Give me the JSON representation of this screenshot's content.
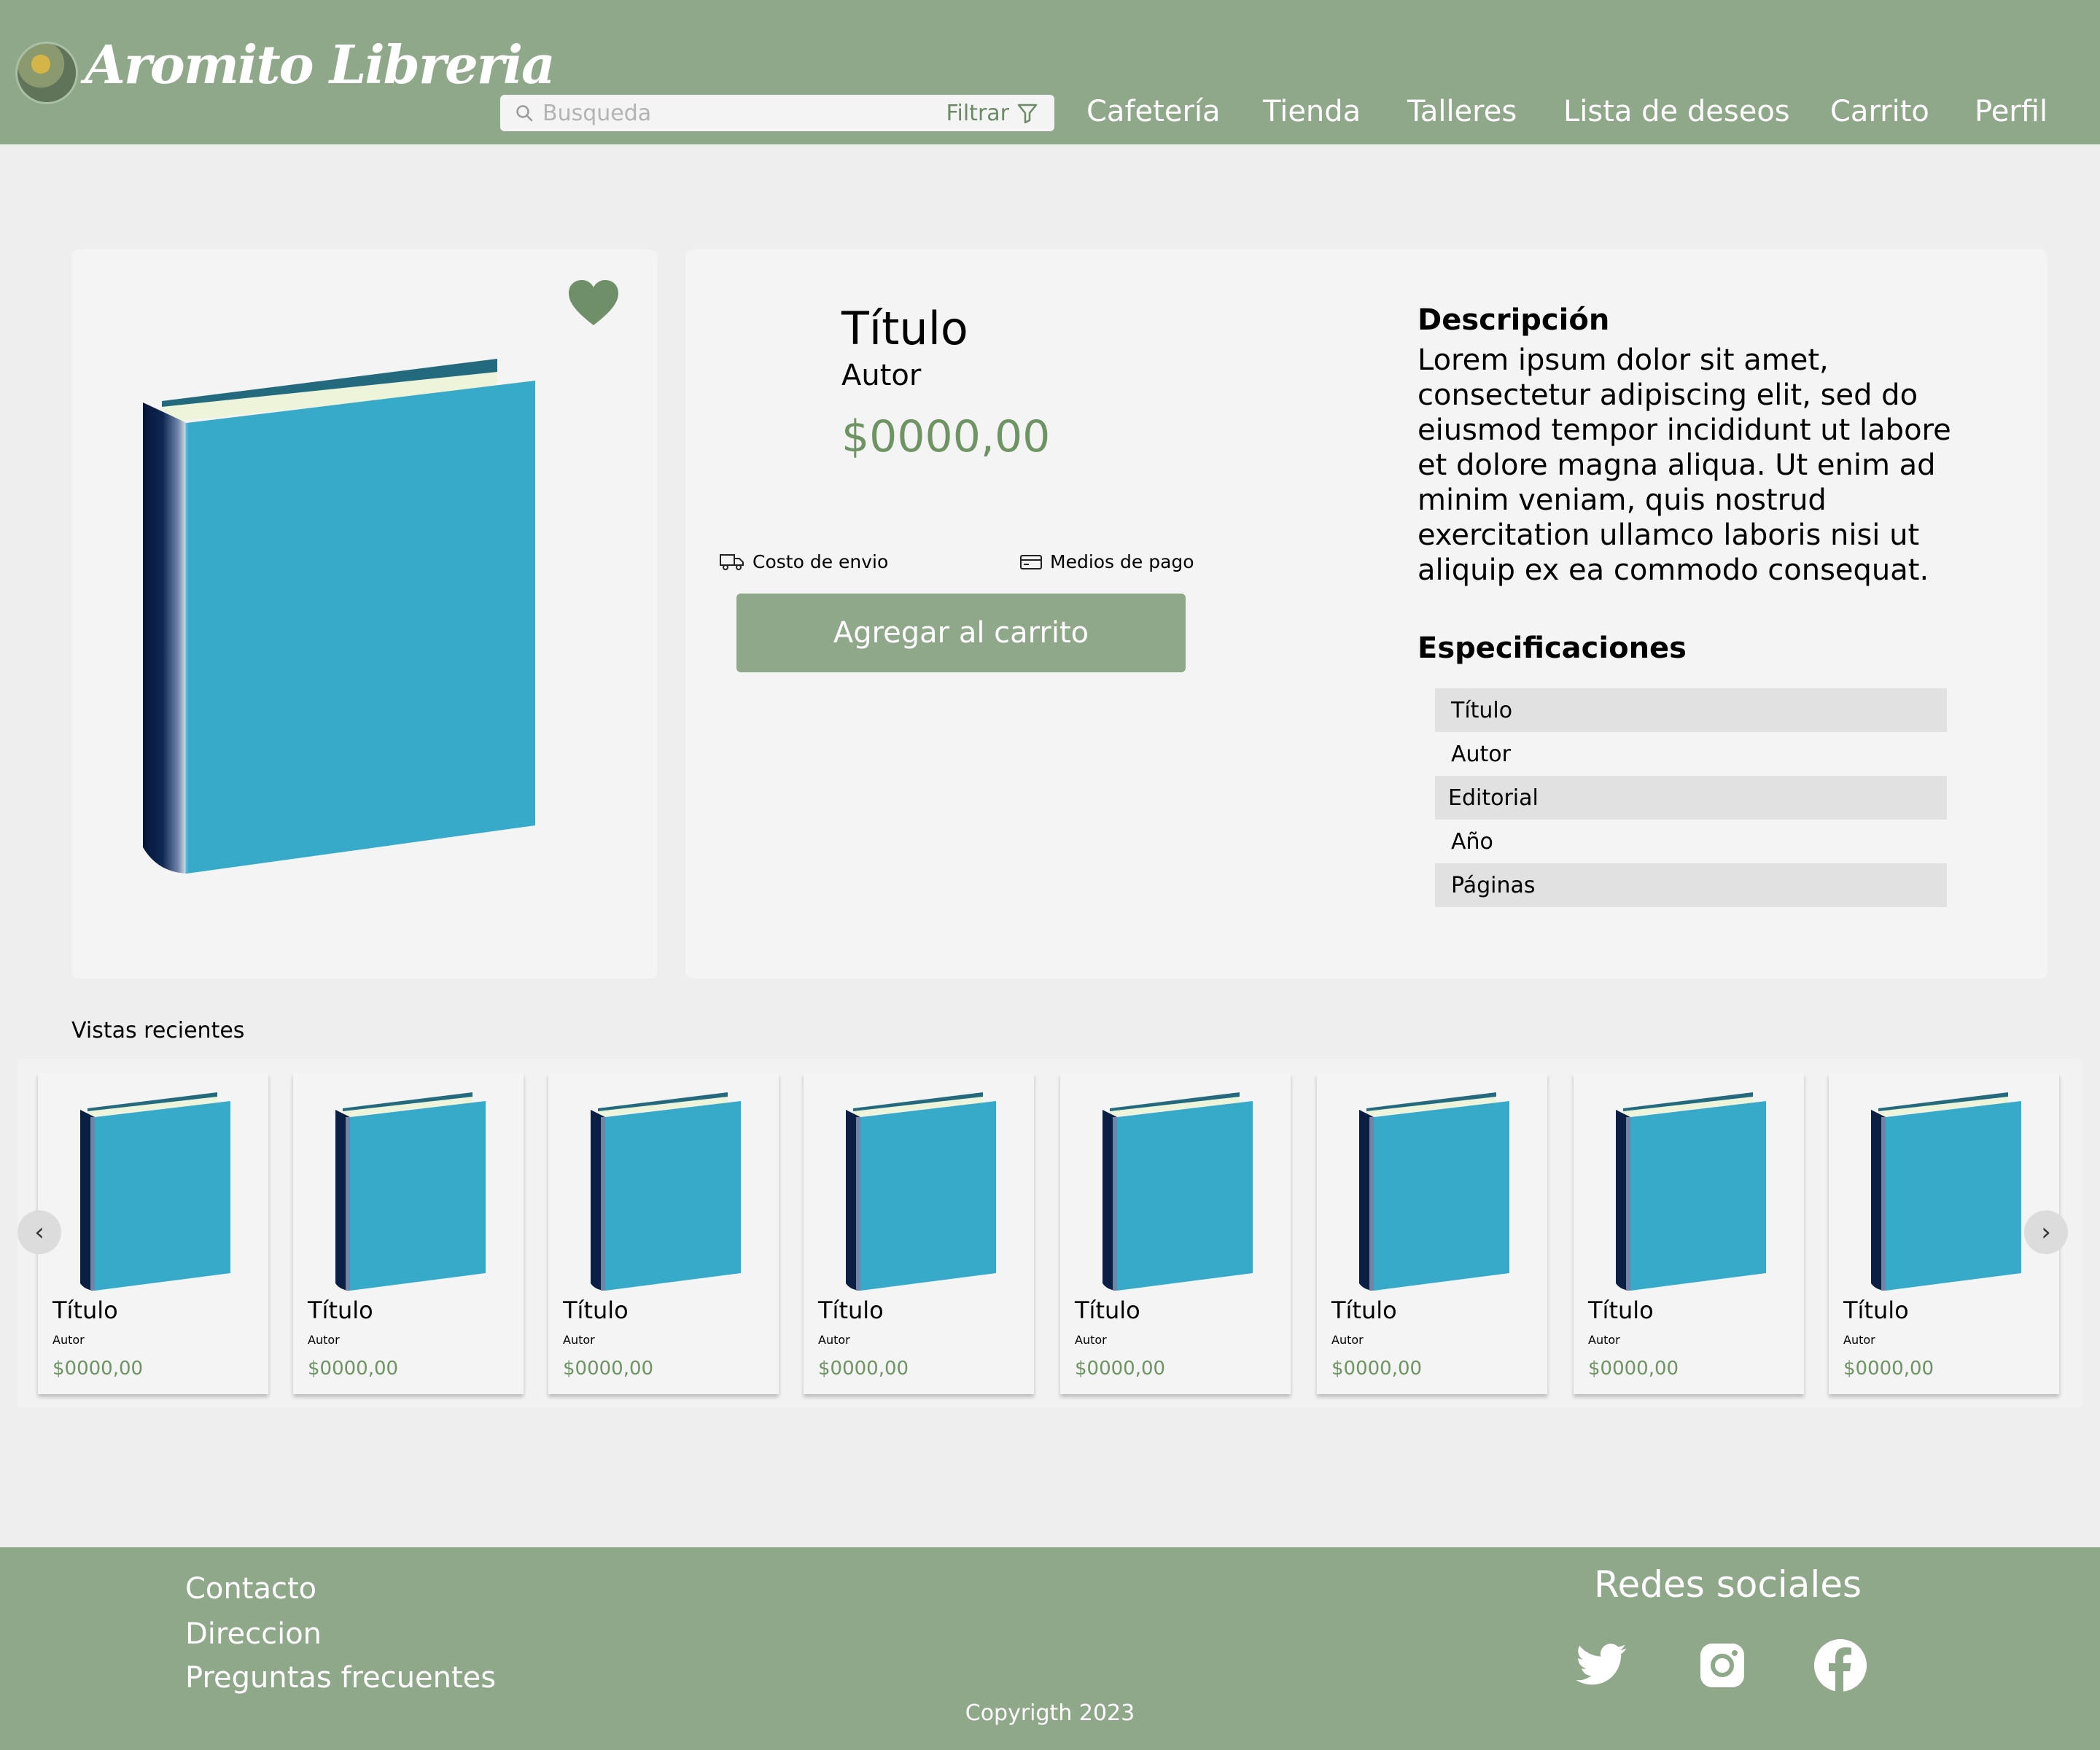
{
  "header": {
    "brand": "Aromito Libreria",
    "search_placeholder": "Busqueda",
    "filter_label": "Filtrar",
    "nav": [
      "Cafetería",
      "Tienda",
      "Talleres",
      "Lista de deseos",
      "Carrito",
      "Perfil"
    ]
  },
  "product": {
    "title": "Título",
    "author": "Autor",
    "price": "$0000,00",
    "shipping_label": "Costo de envio",
    "payment_label": "Medios de pago",
    "add_to_cart": "Agregar al carrito",
    "description_heading": "Descripción",
    "description": "Lorem ipsum dolor sit amet, consectetur adipiscing elit, sed do eiusmod tempor incididunt ut labore et dolore magna aliqua. Ut enim ad minim veniam, quis nostrud exercitation ullamco laboris nisi ut aliquip ex ea commodo consequat.",
    "specs_heading": "Especificaciones",
    "specs": [
      "Título",
      "Autor",
      "Editorial",
      "Año",
      "Páginas"
    ]
  },
  "recent": {
    "label": "Vistas recientes",
    "items": [
      {
        "title": "Título",
        "author": "Autor",
        "price": "$0000,00"
      },
      {
        "title": "Título",
        "author": "Autor",
        "price": "$0000,00"
      },
      {
        "title": "Título",
        "author": "Autor",
        "price": "$0000,00"
      },
      {
        "title": "Título",
        "author": "Autor",
        "price": "$0000,00"
      },
      {
        "title": "Título",
        "author": "Autor",
        "price": "$0000,00"
      },
      {
        "title": "Título",
        "author": "Autor",
        "price": "$0000,00"
      },
      {
        "title": "Título",
        "author": "Autor",
        "price": "$0000,00"
      },
      {
        "title": "Título",
        "author": "Autor",
        "price": "$0000,00"
      }
    ],
    "prev_glyph": "‹",
    "next_glyph": "›"
  },
  "footer": {
    "links": [
      "Contacto",
      "Direccion",
      "Preguntas frecuentes"
    ],
    "social_heading": "Redes sociales",
    "social_icons": [
      "twitter-icon",
      "instagram-icon",
      "facebook-icon"
    ],
    "copyright": "Copyrigth 2023"
  },
  "colors": {
    "header_green": "#8fa889",
    "price_green": "#6e9463",
    "heart_green": "#6f8f68",
    "book_blue": "#38aac9",
    "book_spine": "#0b1f45",
    "background": "#eeeeee",
    "card": "#f4f4f4"
  }
}
